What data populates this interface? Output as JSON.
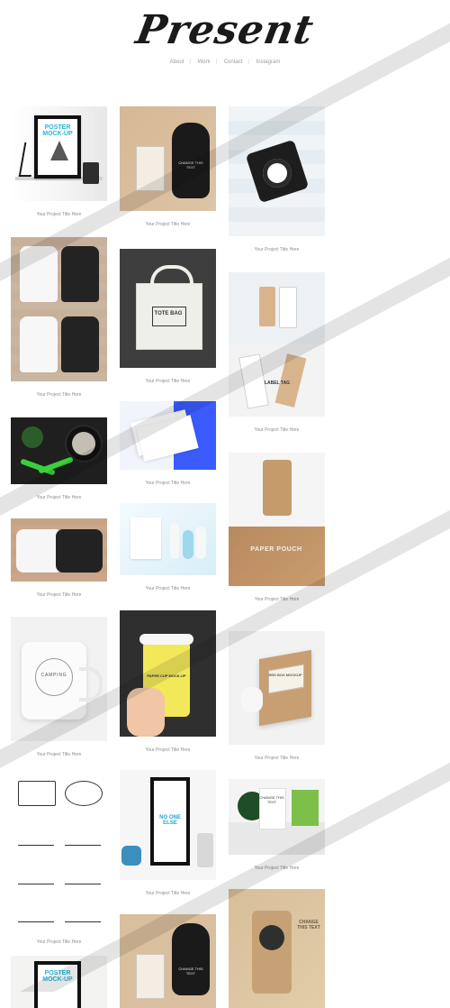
{
  "site": {
    "logo_text": "Present",
    "nav": [
      {
        "label": "About"
      },
      {
        "label": "Work"
      },
      {
        "label": "Contact"
      },
      {
        "label": "Instagram"
      }
    ]
  },
  "gallery": {
    "caption_text": "Your Project Title Here",
    "columns": [
      [
        {
          "name": "poster-mockup",
          "caption": "Your Project Title Here",
          "thumb_text": "POSTER MOCK-UP"
        },
        {
          "name": "tank-tops",
          "caption": "Your Project Title Here",
          "thumb_text": ""
        },
        {
          "name": "food-scissors",
          "caption": "Your Project Title Here",
          "thumb_text": ""
        },
        {
          "name": "long-sleeves",
          "caption": "Your Project Title Here",
          "thumb_text": ""
        },
        {
          "name": "camping-mug",
          "caption": "Your Project Title Here",
          "thumb_text": "CAMPING"
        },
        {
          "name": "icon-set",
          "caption": "Your Project Title Here",
          "thumb_text": ""
        },
        {
          "name": "poster-mockup-2",
          "caption": "",
          "thumb_text": "POSTER MOCK-UP"
        }
      ],
      [
        {
          "name": "bag-and-cards",
          "caption": "Your Project Title Here",
          "thumb_text": "CHANGE THIS TEXT"
        },
        {
          "name": "tote-bag",
          "caption": "Your Project Title Here",
          "thumb_text": "TOTE BAG"
        },
        {
          "name": "business-cards",
          "caption": "Your Project Title Here",
          "thumb_text": ""
        },
        {
          "name": "cosmetics",
          "caption": "Your Project Title Here",
          "thumb_text": ""
        },
        {
          "name": "coffee-cup",
          "caption": "Your Project Title Here",
          "thumb_text": "PAPER CUP MOCK-UP"
        },
        {
          "name": "framed-print",
          "caption": "Your Project Title Here",
          "thumb_text": "NO ONE ELSE"
        },
        {
          "name": "bag-and-cards-2",
          "caption": "",
          "thumb_text": "CHANGE THIS TEXT"
        }
      ],
      [
        {
          "name": "camera",
          "caption": "Your Project Title Here",
          "thumb_text": ""
        },
        {
          "name": "label-tags",
          "caption": "Your Project Title Here",
          "thumb_text": "LABEL TAG"
        },
        {
          "name": "pouch",
          "caption": "Your Project Title Here",
          "thumb_text": "PAPER POUCH"
        },
        {
          "name": "box",
          "caption": "Your Project Title Here",
          "thumb_text": "RED BOX MOCKUP"
        },
        {
          "name": "bonsai",
          "caption": "Your Project Title Here",
          "thumb_text": "CHANGE THIS TEXT"
        },
        {
          "name": "paper-bag",
          "caption": "",
          "thumb_text": "CHANGE THIS TEXT"
        }
      ]
    ]
  },
  "colors": {
    "text_dark": "#1a1a1a",
    "nav_gray": "#9a9a9a",
    "caption_gray": "#8d8d8d"
  }
}
